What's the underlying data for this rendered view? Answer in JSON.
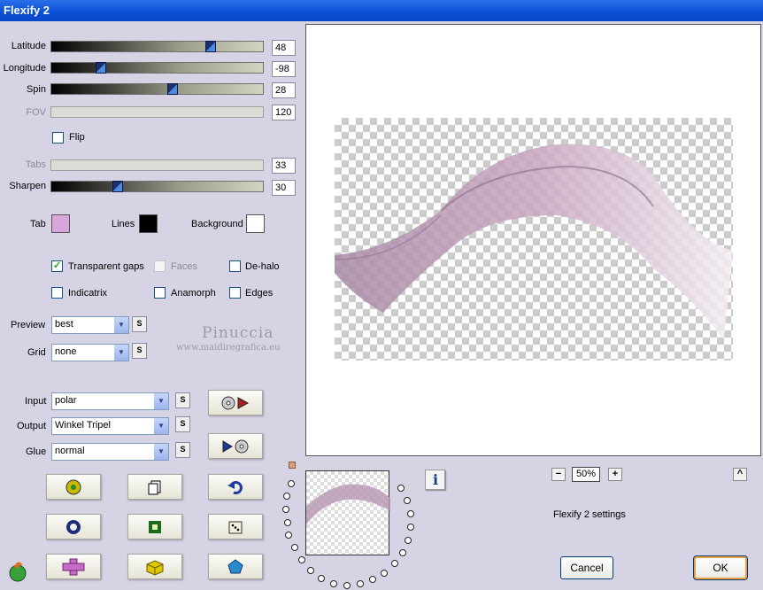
{
  "window": {
    "title": "Flexify 2"
  },
  "sliders": [
    {
      "label": "Latitude",
      "value": "48",
      "enabled": true,
      "level": 0.76
    },
    {
      "label": "Longitude",
      "value": "-98",
      "enabled": true,
      "level": 0.22
    },
    {
      "label": "Spin",
      "value": "28",
      "enabled": true,
      "level": 0.57
    },
    {
      "label": "FOV",
      "value": "120",
      "enabled": false
    },
    {
      "label": "Tabs",
      "value": "33",
      "enabled": false
    },
    {
      "label": "Sharpen",
      "value": "30",
      "enabled": true,
      "level": 0.3
    }
  ],
  "flip": {
    "label": "Flip",
    "checked": false
  },
  "colors": {
    "tab": {
      "label": "Tab",
      "color": "#d9a6dc"
    },
    "lines": {
      "label": "Lines",
      "color": "#000000"
    },
    "background": {
      "label": "Background",
      "color": "#ffffff"
    }
  },
  "options": {
    "transparent_gaps": {
      "label": "Transparent gaps",
      "checked": true
    },
    "faces": {
      "label": "Faces",
      "checked": false,
      "enabled": false
    },
    "de_halo": {
      "label": "De-halo",
      "checked": false
    },
    "indicatrix": {
      "label": "Indicatrix",
      "checked": false
    },
    "anamorph": {
      "label": "Anamorph",
      "checked": false
    },
    "edges": {
      "label": "Edges",
      "checked": false
    }
  },
  "preview_select": {
    "label": "Preview",
    "value": "best"
  },
  "grid_select": {
    "label": "Grid",
    "value": "none"
  },
  "watermark": {
    "name": "Pinuccia",
    "site": "www.maidiregrafica.eu"
  },
  "input_select": {
    "label": "Input",
    "value": "polar"
  },
  "output_select": {
    "label": "Output",
    "value": "Winkel Tripel"
  },
  "glue_select": {
    "label": "Glue",
    "value": "normal"
  },
  "s_button_label": "S",
  "zoom": {
    "value": "50%",
    "minus": "−",
    "plus": "+"
  },
  "settings_label": "Flexify 2 settings",
  "buttons": {
    "cancel": "Cancel",
    "ok": "OK"
  },
  "info_glyph": "i",
  "collapse_glyph": "^"
}
